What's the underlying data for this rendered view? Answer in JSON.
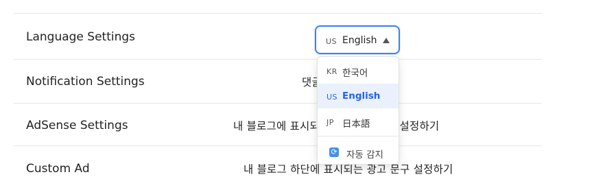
{
  "settings": {
    "rows": [
      {
        "label": "Language Settings",
        "value": ""
      },
      {
        "label": "Notification Settings",
        "value": "댓글 알림 설정하기"
      },
      {
        "label": "AdSense Settings",
        "value": "내 블로그에 표시되는 애드센스 광고 설정하기"
      },
      {
        "label": "Custom Ad",
        "value": "내 블로그 하단에 표시되는 광고 문구 설정하기"
      }
    ]
  },
  "language_select": {
    "selected_code": "US",
    "selected_name": "English",
    "arrow_icon": "triangle-up-icon",
    "options": [
      {
        "code": "KR",
        "name": "한국어",
        "selected": false
      },
      {
        "code": "US",
        "name": "English",
        "selected": true
      },
      {
        "code": "JP",
        "name": "日本語",
        "selected": false
      }
    ],
    "auto_detect": {
      "icon": "refresh-icon",
      "label": "자동 감지"
    }
  },
  "colors": {
    "accent": "#3b82f6",
    "selected_bg": "#eaf1fd",
    "selected_text": "#2563eb"
  }
}
